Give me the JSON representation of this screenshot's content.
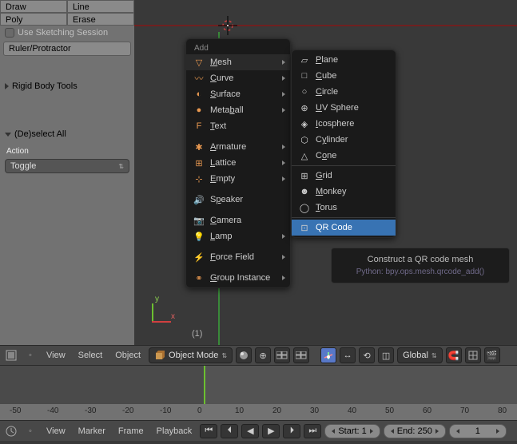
{
  "left_panel": {
    "buttons": {
      "draw": "Draw",
      "line": "Line",
      "poly": "Poly",
      "erase": "Erase"
    },
    "sketch_session": "Use Sketching Session",
    "ruler": "Ruler/Protractor",
    "rigid_body": "Rigid Body Tools",
    "deselect_header": "(De)select All",
    "action_label": "Action",
    "action_value": "Toggle"
  },
  "viewport": {
    "label": "(1)",
    "axis_x": "x",
    "axis_y": "y"
  },
  "menu_add": {
    "title": "Add",
    "items": [
      "Mesh",
      "Curve",
      "Surface",
      "Metaball",
      "Text",
      "Armature",
      "Lattice",
      "Empty",
      "Speaker",
      "Camera",
      "Lamp",
      "Force Field",
      "Group Instance"
    ],
    "underline_idx": [
      0,
      0,
      0,
      4,
      0,
      0,
      0,
      0,
      1,
      0,
      0,
      0,
      0
    ],
    "has_sub": [
      true,
      true,
      true,
      true,
      false,
      true,
      true,
      true,
      false,
      false,
      true,
      true,
      true
    ]
  },
  "menu_mesh": {
    "items": [
      "Plane",
      "Cube",
      "Circle",
      "UV Sphere",
      "Icosphere",
      "Cylinder",
      "Cone",
      "Grid",
      "Monkey",
      "Torus",
      "QR Code"
    ],
    "underline_idx": [
      0,
      0,
      0,
      0,
      0,
      1,
      1,
      0,
      0,
      0,
      -1
    ],
    "selected": 10,
    "divider_after": [
      6,
      9
    ]
  },
  "tooltip": {
    "line1": "Construct a QR code mesh",
    "line2": "Python: bpy.ops.mesh.qrcode_add()"
  },
  "toolbar1": {
    "menus": [
      "View",
      "Select",
      "Object"
    ],
    "mode": "Object Mode",
    "global": "Global"
  },
  "timeline": {
    "ticks": [
      -50,
      -40,
      -30,
      -20,
      -10,
      0,
      10,
      20,
      30,
      40,
      50,
      60,
      70,
      80
    ]
  },
  "toolbar2": {
    "menus": [
      "View",
      "Marker",
      "Frame",
      "Playback"
    ],
    "start": "Start: 1",
    "end": "End: 250",
    "current": "1"
  }
}
